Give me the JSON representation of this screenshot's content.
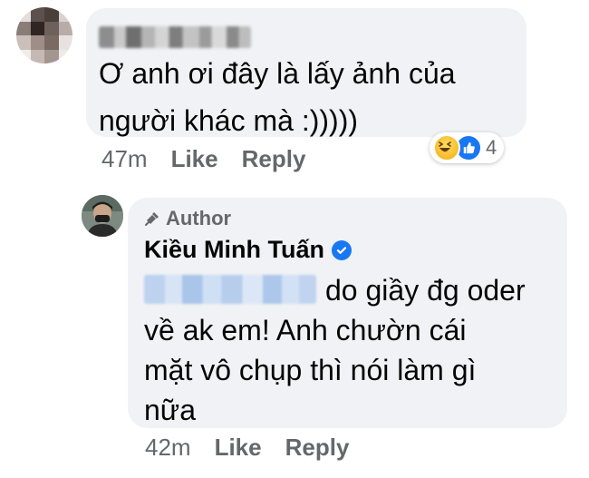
{
  "comment": {
    "text": "Ơ anh ơi đây là lấy ảnh của\nngười khác mà :)))))",
    "time": "47m",
    "like_label": "Like",
    "reply_label": "Reply",
    "reactions": {
      "icons": [
        "haha-icon",
        "like-icon"
      ],
      "count": "4"
    }
  },
  "reply": {
    "badge": "Author",
    "author_name": "Kiều Minh Tuấn",
    "text": "do giầy đg oder\nvề ak em! Anh chườn cái\nmặt vô chụp thì nói làm gì\nnữa",
    "time": "42m",
    "like_label": "Like",
    "reply_label": "Reply"
  },
  "colors": {
    "bubble": "#f0f2f5",
    "meta_text": "#65676b",
    "primary_text": "#050505",
    "facebook_blue": "#1877f2"
  }
}
